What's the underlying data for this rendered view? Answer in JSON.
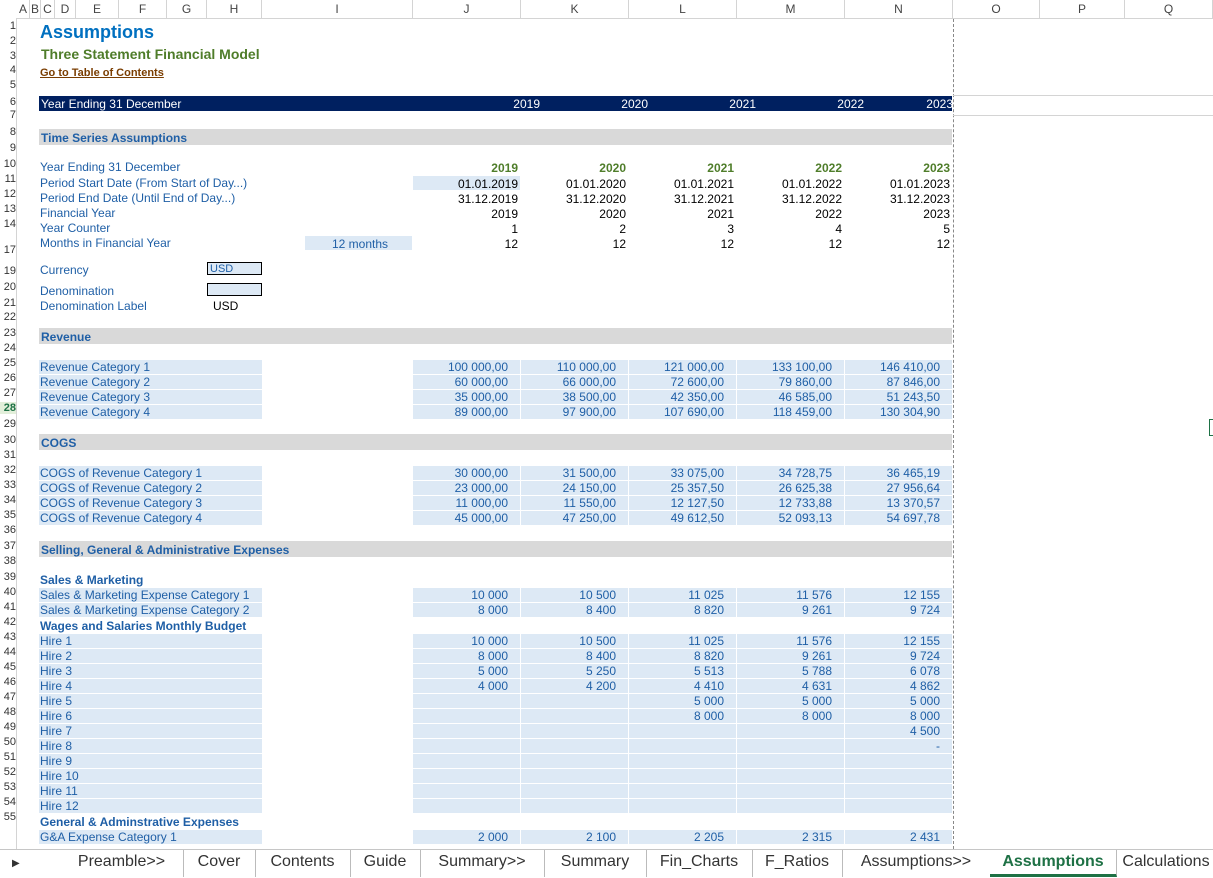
{
  "columns": [
    "A",
    "B",
    "C",
    "D",
    "E",
    "F",
    "G",
    "H",
    "I",
    "J",
    "K",
    "L",
    "M",
    "N",
    "O",
    "P",
    "Q"
  ],
  "rows": [
    "1",
    "2",
    "3",
    "4",
    "5",
    "6",
    "7",
    "8",
    "9",
    "10",
    "11",
    "12",
    "13",
    "14",
    "17",
    "19",
    "20",
    "21",
    "22",
    "23",
    "24",
    "25",
    "26",
    "27",
    "28",
    "29",
    "30",
    "31",
    "32",
    "33",
    "34",
    "35",
    "36",
    "37",
    "38",
    "39",
    "40",
    "41",
    "42",
    "43",
    "44",
    "45",
    "46",
    "47",
    "48",
    "49",
    "50",
    "51",
    "52",
    "53",
    "54",
    "55"
  ],
  "header": {
    "title": "Assumptions",
    "subtitle": "Three Statement Financial Model",
    "link": "Go to Table of Contents"
  },
  "band": {
    "label": "Year Ending 31 December",
    "years": [
      "2019",
      "2020",
      "2021",
      "2022",
      "2023"
    ]
  },
  "time_series": {
    "section": "Time Series Assumptions",
    "labels": [
      "Year Ending 31 December",
      "Period Start Date (From Start of Day...)",
      "Period End Date (Until End of Day...)",
      "Financial Year",
      "Year Counter",
      "Months in Financial Year"
    ],
    "months_input": "12 months",
    "years": [
      "2019",
      "2020",
      "2021",
      "2022",
      "2023"
    ],
    "start": [
      "01.01.2019",
      "01.01.2020",
      "01.01.2021",
      "01.01.2022",
      "01.01.2023"
    ],
    "end": [
      "31.12.2019",
      "31.12.2020",
      "31.12.2021",
      "31.12.2022",
      "31.12.2023"
    ],
    "fy": [
      "2019",
      "2020",
      "2021",
      "2022",
      "2023"
    ],
    "counter": [
      "1",
      "2",
      "3",
      "4",
      "5"
    ],
    "months": [
      "12",
      "12",
      "12",
      "12",
      "12"
    ]
  },
  "settings": {
    "currency_label": "Currency",
    "currency_value": "USD",
    "denomination_label": "Denomination",
    "denomination_value": "",
    "denom_label_label": "Denomination Label",
    "denom_label_value": "USD"
  },
  "revenue": {
    "section": "Revenue",
    "rows": [
      {
        "label": "Revenue Category 1",
        "values": [
          "100 000,00",
          "110 000,00",
          "121 000,00",
          "133 100,00",
          "146 410,00"
        ]
      },
      {
        "label": "Revenue Category 2",
        "values": [
          "60 000,00",
          "66 000,00",
          "72 600,00",
          "79 860,00",
          "87 846,00"
        ]
      },
      {
        "label": "Revenue Category 3",
        "values": [
          "35 000,00",
          "38 500,00",
          "42 350,00",
          "46 585,00",
          "51 243,50"
        ]
      },
      {
        "label": "Revenue Category 4",
        "values": [
          "89 000,00",
          "97 900,00",
          "107 690,00",
          "118 459,00",
          "130 304,90"
        ]
      }
    ]
  },
  "cogs": {
    "section": "COGS",
    "rows": [
      {
        "label": "COGS of Revenue Category 1",
        "values": [
          "30 000,00",
          "31 500,00",
          "33 075,00",
          "34 728,75",
          "36 465,19"
        ]
      },
      {
        "label": "COGS of Revenue Category 2",
        "values": [
          "23 000,00",
          "24 150,00",
          "25 357,50",
          "26 625,38",
          "27 956,64"
        ]
      },
      {
        "label": "COGS of Revenue Category 3",
        "values": [
          "11 000,00",
          "11 550,00",
          "12 127,50",
          "12 733,88",
          "13 370,57"
        ]
      },
      {
        "label": "COGS of Revenue Category 4",
        "values": [
          "45 000,00",
          "47 250,00",
          "49 612,50",
          "52 093,13",
          "54 697,78"
        ]
      }
    ]
  },
  "sga": {
    "section": "Selling, General & Administrative Expenses",
    "sm_header": "Sales & Marketing",
    "sm_rows": [
      {
        "label": "Sales & Marketing Expense Category 1",
        "values": [
          "10 000",
          "10 500",
          "11 025",
          "11 576",
          "12 155"
        ]
      },
      {
        "label": "Sales & Marketing Expense Category 2",
        "values": [
          "8 000",
          "8 400",
          "8 820",
          "9 261",
          "9 724"
        ]
      }
    ],
    "wages_header": "Wages and Salaries Monthly Budget",
    "hires": [
      {
        "label": "Hire 1",
        "values": [
          "10 000",
          "10 500",
          "11 025",
          "11 576",
          "12 155"
        ]
      },
      {
        "label": "Hire 2",
        "values": [
          "8 000",
          "8 400",
          "8 820",
          "9 261",
          "9 724"
        ]
      },
      {
        "label": "Hire 3",
        "values": [
          "5 000",
          "5 250",
          "5 513",
          "5 788",
          "6 078"
        ]
      },
      {
        "label": "Hire 4",
        "values": [
          "4 000",
          "4 200",
          "4 410",
          "4 631",
          "4 862"
        ]
      },
      {
        "label": "Hire 5",
        "values": [
          "",
          "",
          "5 000",
          "5 000",
          "5 000"
        ]
      },
      {
        "label": "Hire 6",
        "values": [
          "",
          "",
          "8 000",
          "8 000",
          "8 000"
        ]
      },
      {
        "label": "Hire 7",
        "values": [
          "",
          "",
          "",
          "",
          "4 500"
        ]
      },
      {
        "label": "Hire 8",
        "values": [
          "",
          "",
          "",
          "",
          "-"
        ]
      },
      {
        "label": "Hire 9",
        "values": [
          "",
          "",
          "",
          "",
          ""
        ]
      },
      {
        "label": "Hire 10",
        "values": [
          "",
          "",
          "",
          "",
          ""
        ]
      },
      {
        "label": "Hire 11",
        "values": [
          "",
          "",
          "",
          "",
          ""
        ]
      },
      {
        "label": "Hire 12",
        "values": [
          "",
          "",
          "",
          "",
          ""
        ]
      }
    ],
    "ga_header": "General & Adminstrative Expenses",
    "ga_rows": [
      {
        "label": "G&A Expense Category 1",
        "values": [
          "2 000",
          "2 100",
          "2 205",
          "2 315",
          "2 431"
        ]
      }
    ]
  },
  "tabs": [
    {
      "label": "Preamble>>",
      "active": false
    },
    {
      "label": "Cover",
      "active": false
    },
    {
      "label": "Contents",
      "active": false
    },
    {
      "label": "Guide",
      "active": false
    },
    {
      "label": "Summary>>",
      "active": false
    },
    {
      "label": "Summary",
      "active": false
    },
    {
      "label": "Fin_Charts",
      "active": false
    },
    {
      "label": "F_Ratios",
      "active": false
    },
    {
      "label": "Assumptions>>",
      "active": false
    },
    {
      "label": "Assumptions",
      "active": true
    },
    {
      "label": "Calculations",
      "active": false
    }
  ]
}
